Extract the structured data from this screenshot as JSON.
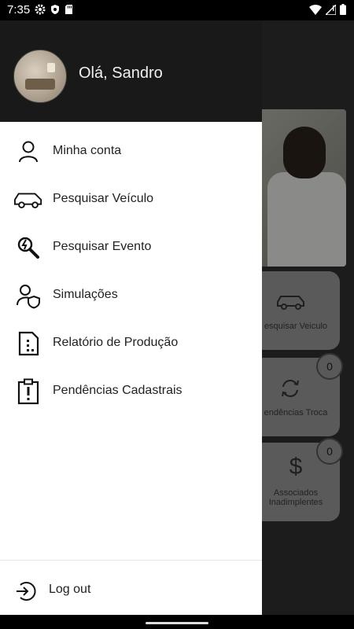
{
  "status_bar": {
    "time": "7:35"
  },
  "drawer": {
    "greeting": "Olá, Sandro",
    "menu": [
      {
        "label": "Minha conta",
        "icon": "user-icon"
      },
      {
        "label": "Pesquisar Veículo",
        "icon": "car-icon"
      },
      {
        "label": "Pesquisar Evento",
        "icon": "search-event-icon"
      },
      {
        "label": "Simulações",
        "icon": "user-shield-icon"
      },
      {
        "label": "Relatório de Produção",
        "icon": "report-icon"
      },
      {
        "label": "Pendências Cadastrais",
        "icon": "clipboard-alert-icon"
      }
    ],
    "logout_label": "Log out"
  },
  "background": {
    "cards": [
      {
        "label": "esquisar Veiculo",
        "icon": "car-icon"
      },
      {
        "label": "endências Troca",
        "icon": "sync-icon",
        "badge": "0"
      },
      {
        "label": "Associados\nInadimplentes",
        "icon": "dollar-icon",
        "badge": "0"
      }
    ]
  }
}
